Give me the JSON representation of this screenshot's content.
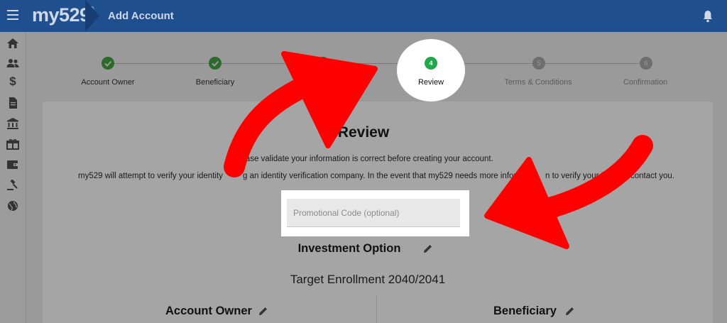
{
  "header": {
    "logo": "my529",
    "logo_mark": "®",
    "title": "Add Account",
    "menu_icon": "hamburger-menu-icon",
    "bell_icon": "bell-icon"
  },
  "sidebar": {
    "icons": [
      "home-icon",
      "people-icon",
      "dollar-icon",
      "document-icon",
      "bank-icon",
      "gift-icon",
      "wallet-icon",
      "gavel-icon",
      "globe-icon"
    ]
  },
  "stepper": {
    "steps": [
      {
        "label": "Account Owner",
        "status": "complete"
      },
      {
        "label": "Beneficiary",
        "status": "complete"
      },
      {
        "label": "In",
        "status": "complete"
      },
      {
        "label": "Review",
        "status": "current",
        "number": "4"
      },
      {
        "label": "Terms & Conditions",
        "status": "pending",
        "number": "5"
      },
      {
        "label": "Confirmation",
        "status": "pending",
        "number": "6"
      }
    ]
  },
  "review": {
    "title": "Review",
    "instruction": "Please validate your information is correct before creating your account.",
    "verify_text_left": "my529 will attempt to verify your identity",
    "verify_text_mid": "g an identity verification company. In the event that my529 needs more infor",
    "verify_text_right": "n to verify your ID,",
    "verify_text_end": "contact you.",
    "promo_placeholder": "Promotional Code (optional)",
    "investment_option_heading": "Investment Option",
    "investment_option_value": "Target Enrollment 2040/2041",
    "account_owner_heading": "Account Owner",
    "beneficiary_heading": "Beneficiary"
  },
  "colors": {
    "header_bg": "#1f4f8f",
    "overlay_gray": "#9a9a9a",
    "step_complete": "#2b6a2b",
    "step_current": "#22a84a",
    "arrow_red": "#ff0000",
    "spotlight": "#ffffff"
  }
}
